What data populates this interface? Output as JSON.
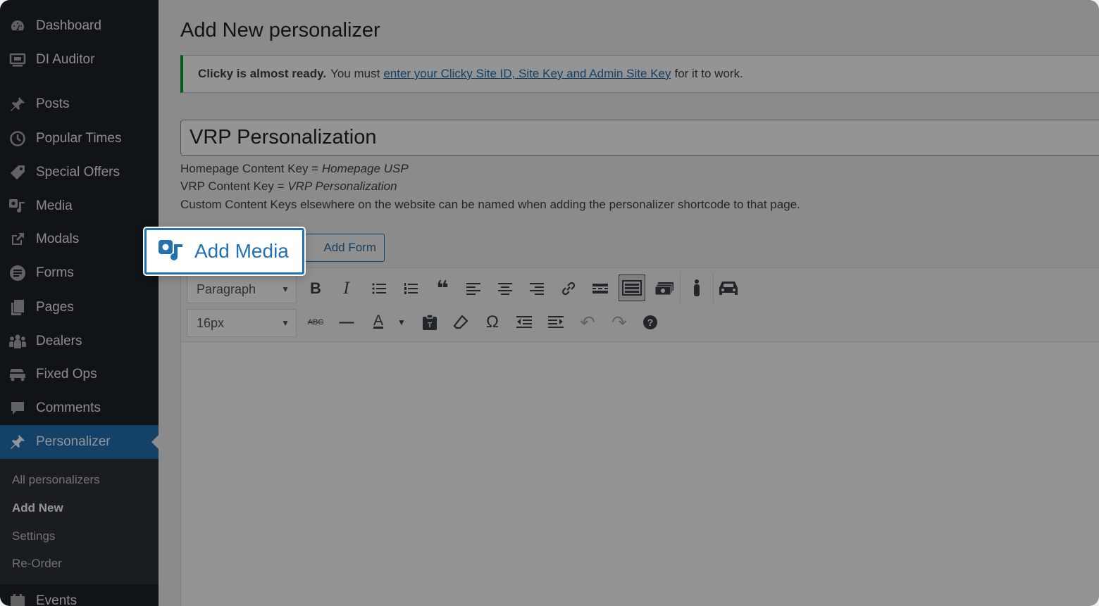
{
  "sidebar": {
    "items": [
      {
        "label": "Dashboard",
        "icon": "dashboard-icon"
      },
      {
        "label": "DI Auditor",
        "icon": "monitor-icon"
      },
      {
        "label": "Posts",
        "icon": "pin-icon"
      },
      {
        "label": "Popular Times",
        "icon": "clock-icon"
      },
      {
        "label": "Special Offers",
        "icon": "tag-icon"
      },
      {
        "label": "Media",
        "icon": "media-icon"
      },
      {
        "label": "Modals",
        "icon": "external-link-icon"
      },
      {
        "label": "Forms",
        "icon": "forms-icon"
      },
      {
        "label": "Pages",
        "icon": "pages-icon"
      },
      {
        "label": "Dealers",
        "icon": "groups-icon"
      },
      {
        "label": "Fixed Ops",
        "icon": "car-stack-icon"
      },
      {
        "label": "Comments",
        "icon": "comment-icon"
      },
      {
        "label": "Personalizer",
        "icon": "pin-icon"
      },
      {
        "label": "Events",
        "icon": "calendar-icon"
      }
    ],
    "submenu": [
      {
        "label": "All personalizers"
      },
      {
        "label": "Add New"
      },
      {
        "label": "Settings"
      },
      {
        "label": "Re-Order"
      }
    ]
  },
  "page": {
    "title": "Add New personalizer"
  },
  "notice": {
    "strong": "Clicky is almost ready.",
    "before": "You must",
    "link": "enter your Clicky Site ID, Site Key and Admin Site Key",
    "after": "for it to work."
  },
  "post": {
    "title_value": "VRP Personalization",
    "help": [
      {
        "label": "Homepage Content Key = ",
        "value": "Homepage USP"
      },
      {
        "label": "VRP Content Key = ",
        "value": "VRP Personalization"
      },
      {
        "label": "Custom Content Keys elsewhere on the website can be named when adding the personalizer shortcode to that page.",
        "value": ""
      }
    ]
  },
  "buttons": {
    "add_media": "Add Media",
    "add_form": "Add Form"
  },
  "toolbar": {
    "format_select": "Paragraph",
    "size_select": "16px",
    "glyphs": {
      "bold": "B",
      "italic": "I",
      "bullets": "☰",
      "numbers": "☷",
      "quote": "❝",
      "align_left": "☰",
      "align_center": "☰",
      "align_right": "☰",
      "link": "🔗",
      "more": "▬",
      "strike": "ABC",
      "hr": "—",
      "text_color": "A",
      "special_char": "Ω",
      "undo": "↶",
      "redo": "↷",
      "help": "?"
    }
  },
  "colors": {
    "sidebar_bg": "#1d2327",
    "accent": "#2271b1",
    "notice_green": "#00a32a"
  }
}
